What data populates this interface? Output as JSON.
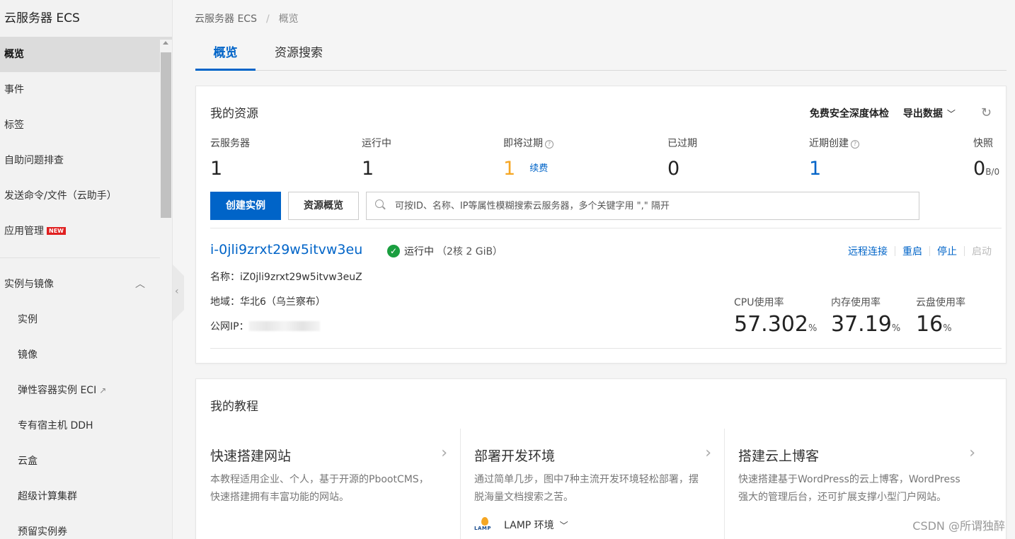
{
  "sidebar": {
    "title": "云服务器 ECS",
    "items": [
      {
        "label": "概览"
      },
      {
        "label": "事件"
      },
      {
        "label": "标签"
      },
      {
        "label": "自助问题排查"
      },
      {
        "label": "发送命令/文件（云助手）"
      },
      {
        "label": "应用管理",
        "badge": "NEW"
      }
    ],
    "group": {
      "label": "实例与镜像",
      "icon": "chevron-up-icon"
    },
    "sub_items": [
      {
        "label": "实例"
      },
      {
        "label": "镜像"
      },
      {
        "label": "弹性容器实例 ECI"
      },
      {
        "label": "专有宿主机 DDH"
      },
      {
        "label": "云盒"
      },
      {
        "label": "超级计算集群"
      },
      {
        "label": "预留实例券"
      }
    ]
  },
  "breadcrumb": {
    "root": "云服务器 ECS",
    "sep": "/",
    "current": "概览"
  },
  "tabs": [
    {
      "label": "概览",
      "active": true
    },
    {
      "label": "资源搜索",
      "active": false
    }
  ],
  "resources": {
    "title": "我的资源",
    "actions": {
      "security": "免费安全深度体检",
      "export": "导出数据"
    },
    "stats": {
      "servers": {
        "label": "云服务器",
        "value": "1"
      },
      "running": {
        "label": "运行中",
        "value": "1"
      },
      "expiring": {
        "label": "即将过期",
        "value": "1",
        "link": "续费"
      },
      "expired": {
        "label": "已过期",
        "value": "0"
      },
      "recent": {
        "label": "近期创建",
        "value": "1"
      },
      "snapshot": {
        "label": "快照",
        "value": "0",
        "unit": "B/0"
      }
    },
    "buttons": {
      "create": "创建实例",
      "overview": "资源概览"
    },
    "search_placeholder": "可按ID、名称、IP等属性模糊搜索云服务器，多个关键字用 \",\" 隔开",
    "instance": {
      "id": "i-0jli9zrxt29w5itvw3eu",
      "status": "运行中",
      "spec": "（2核 2 GiB）",
      "name_label": "名称：",
      "name": "iZ0jli9zrxt29w5itvw3euZ",
      "region_label": "地域：",
      "region": "华北6（乌兰察布）",
      "ip_label": "公网IP：",
      "ops": {
        "remote": "远程连接",
        "restart": "重启",
        "stop": "停止",
        "start": "启动"
      },
      "usage": {
        "cpu": {
          "label": "CPU使用率",
          "value": "57.302",
          "unit": "%"
        },
        "mem": {
          "label": "内存使用率",
          "value": "37.19",
          "unit": "%"
        },
        "disk": {
          "label": "云盘使用率",
          "value": "16",
          "unit": "%"
        }
      }
    }
  },
  "tutorials": {
    "title": "我的教程",
    "items": [
      {
        "title": "快速搭建网站",
        "desc": "本教程适用企业、个人，基于开源的PbootCMS，快速搭建拥有丰富功能的网站。"
      },
      {
        "title": "部署开发环境",
        "desc": "通过简单几步，图中7种主流开发环境轻松部署，摆脱海量文档搜索之苦。",
        "env": "LAMP 环境",
        "env_logo_text": "LAMP"
      },
      {
        "title": "搭建云上博客",
        "desc": "快速搭建基于WordPress的云上博客，WordPress强大的管理后台，还可扩展支撑小型门户网站。"
      }
    ]
  },
  "watermark": "CSDN @所谓独醉",
  "colors": {
    "accent": "#0064c8",
    "orange": "#f5a623",
    "success": "#1a9e3f",
    "badge": "#e02020"
  }
}
